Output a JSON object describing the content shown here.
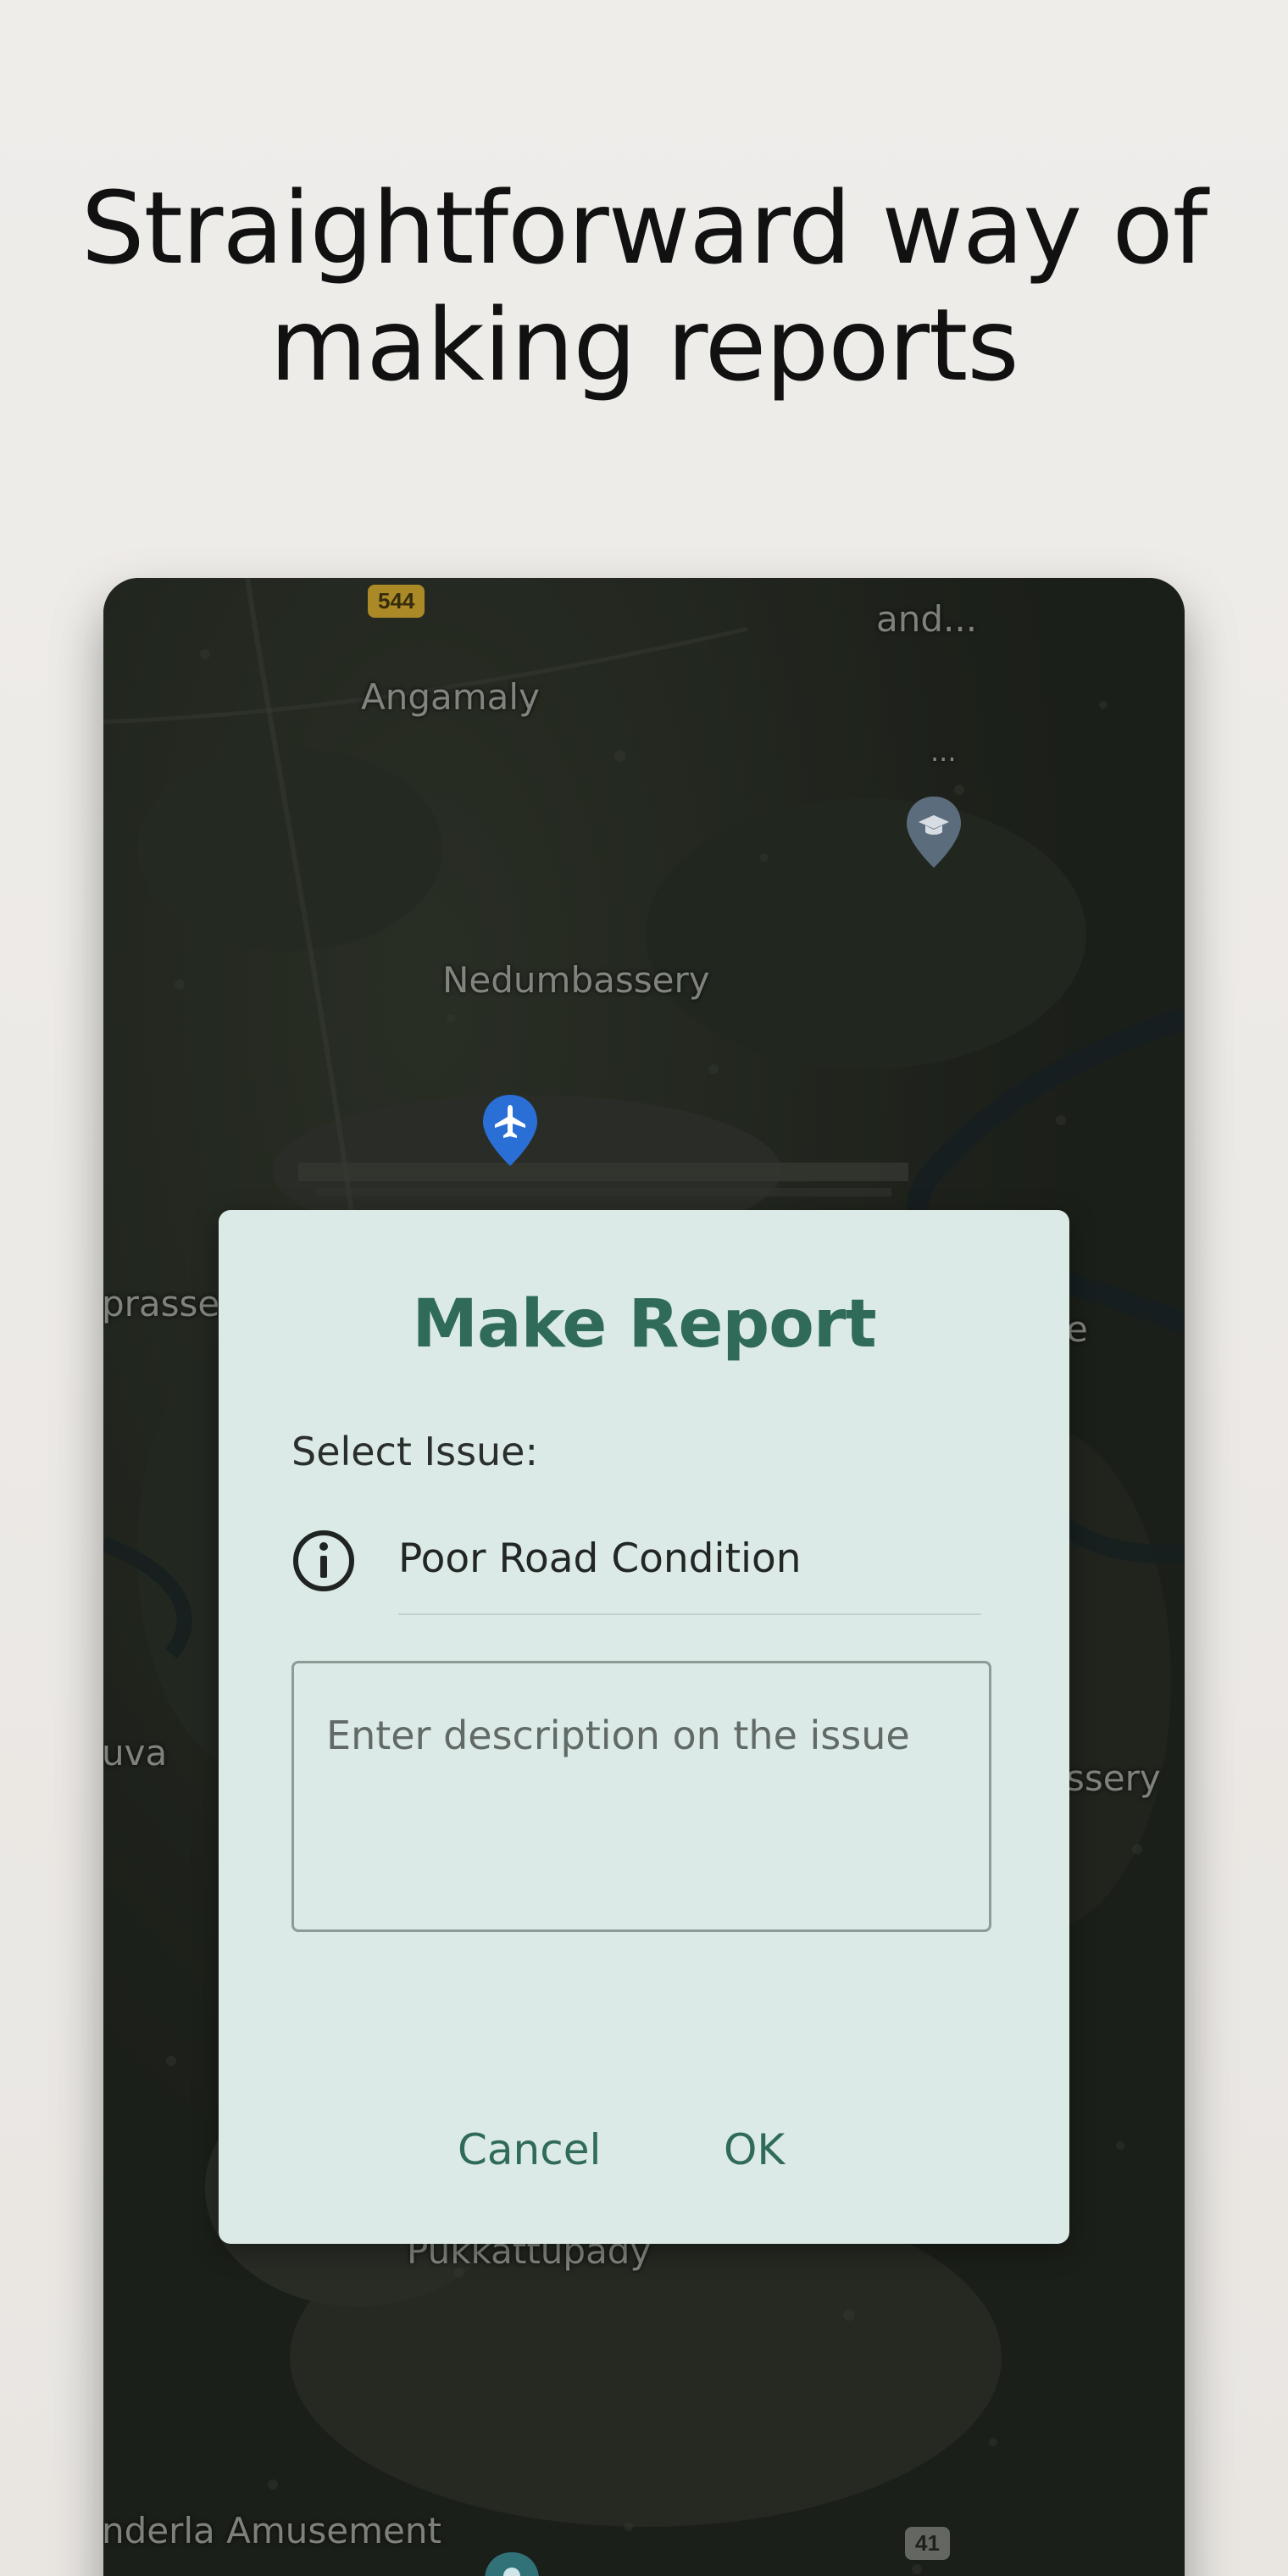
{
  "headline": {
    "line1": "Straightforward way of",
    "line2": "making reports"
  },
  "map": {
    "labels": {
      "top_right_partial": "and...",
      "angamaly": "Angamaly",
      "nedumbassery": "Nedumbassery",
      "left_partial_1": "prasse",
      "right_partial_1": "e",
      "left_partial_2": "uva",
      "right_partial_2": "ssery",
      "pukkattupady": "Pukkattupady",
      "bottom_left": "nderla Amusement",
      "dots": "..."
    },
    "shields": {
      "nh544": "544",
      "nh41": "41"
    },
    "icons": {
      "airport": "airplane-pin-icon",
      "school": "graduation-cap-pin-icon",
      "park": "park-pin-icon"
    }
  },
  "dialog": {
    "title": "Make Report",
    "select_label": "Select Issue:",
    "selected_issue": "Poor Road Condition",
    "description_placeholder": "Enter description on the issue",
    "cancel_label": "Cancel",
    "ok_label": "OK",
    "accent_color": "#2f6b58",
    "background_color": "#dbeae6"
  }
}
